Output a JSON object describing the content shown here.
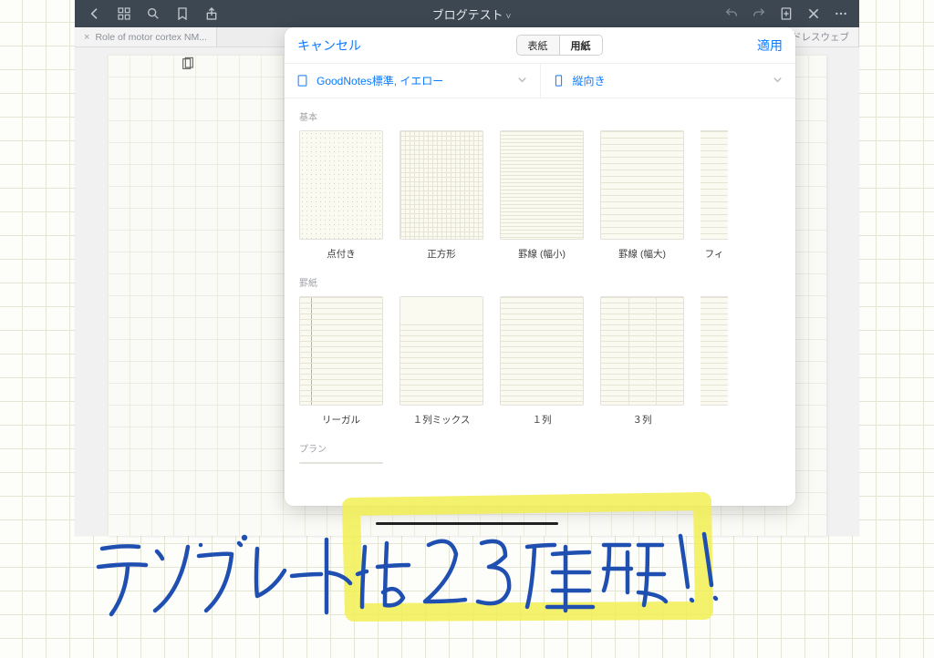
{
  "toolbar": {
    "title": "ブログテスト"
  },
  "tabs": {
    "left": "Role of motor cortex NM...",
    "right": "エンドレスウェブ"
  },
  "modal": {
    "cancel": "キャンセル",
    "apply": "適用",
    "seg_left": "表紙",
    "seg_right": "用紙",
    "size_label": "GoodNotes標準, イエロー",
    "orient_label": "縦向き",
    "sections": {
      "basic": "基本",
      "lined": "罫紙",
      "plan": "プラン"
    },
    "templates_basic": [
      "点付き",
      "正方形",
      "罫線 (幅小)",
      "罫線 (幅大)",
      "フィ"
    ],
    "templates_lined": [
      "リーガル",
      "１列ミックス",
      "１列",
      "３列"
    ]
  },
  "handwriting": {
    "text": "テンプレートは 23 種類！！"
  }
}
